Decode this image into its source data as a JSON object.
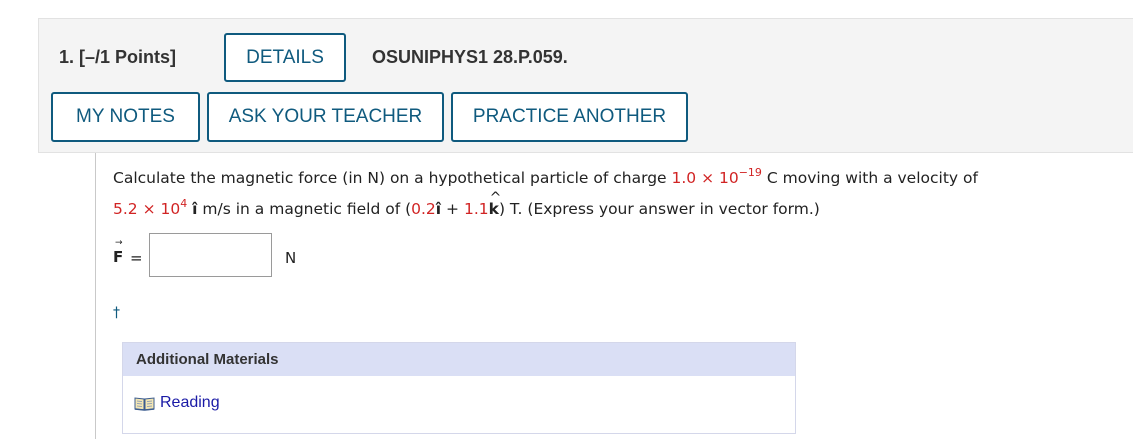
{
  "header": {
    "question_number": "1.  [–/1 Points]",
    "details_label": "DETAILS",
    "question_code": "OSUNIPHYS1 28.P.059."
  },
  "actions": {
    "my_notes": "MY NOTES",
    "ask_teacher": "ASK YOUR TEACHER",
    "practice_another": "PRACTICE ANOTHER"
  },
  "question": {
    "line1_prefix": "Calculate the magnetic force (in N) on a hypothetical particle of charge ",
    "charge_mantissa": "1.0 × 10",
    "charge_exponent": "−19",
    "line1_suffix": " C moving with a velocity of",
    "velocity_mantissa": "5.2 × 10",
    "velocity_exponent": "4",
    "unit_vector_i": "î",
    "line2_mid": " m/s in a magnetic field of (",
    "field_i": "0.2",
    "plus": " + ",
    "field_k": "1.1",
    "unit_vector_k": "k",
    "line2_suffix": ") T. (Express your answer in vector form.)"
  },
  "answer": {
    "variable": "F",
    "arrow": "→",
    "equals": "=",
    "value": "",
    "unit": "N",
    "dagger": "†"
  },
  "additional_materials": {
    "title": "Additional Materials",
    "reading_label": "Reading",
    "reading_icon": "book-icon"
  },
  "colors": {
    "accent": "#0f5a7e",
    "randomized_value": "#d12424",
    "panel_header": "#dadff5",
    "link": "#1a1aa6"
  }
}
